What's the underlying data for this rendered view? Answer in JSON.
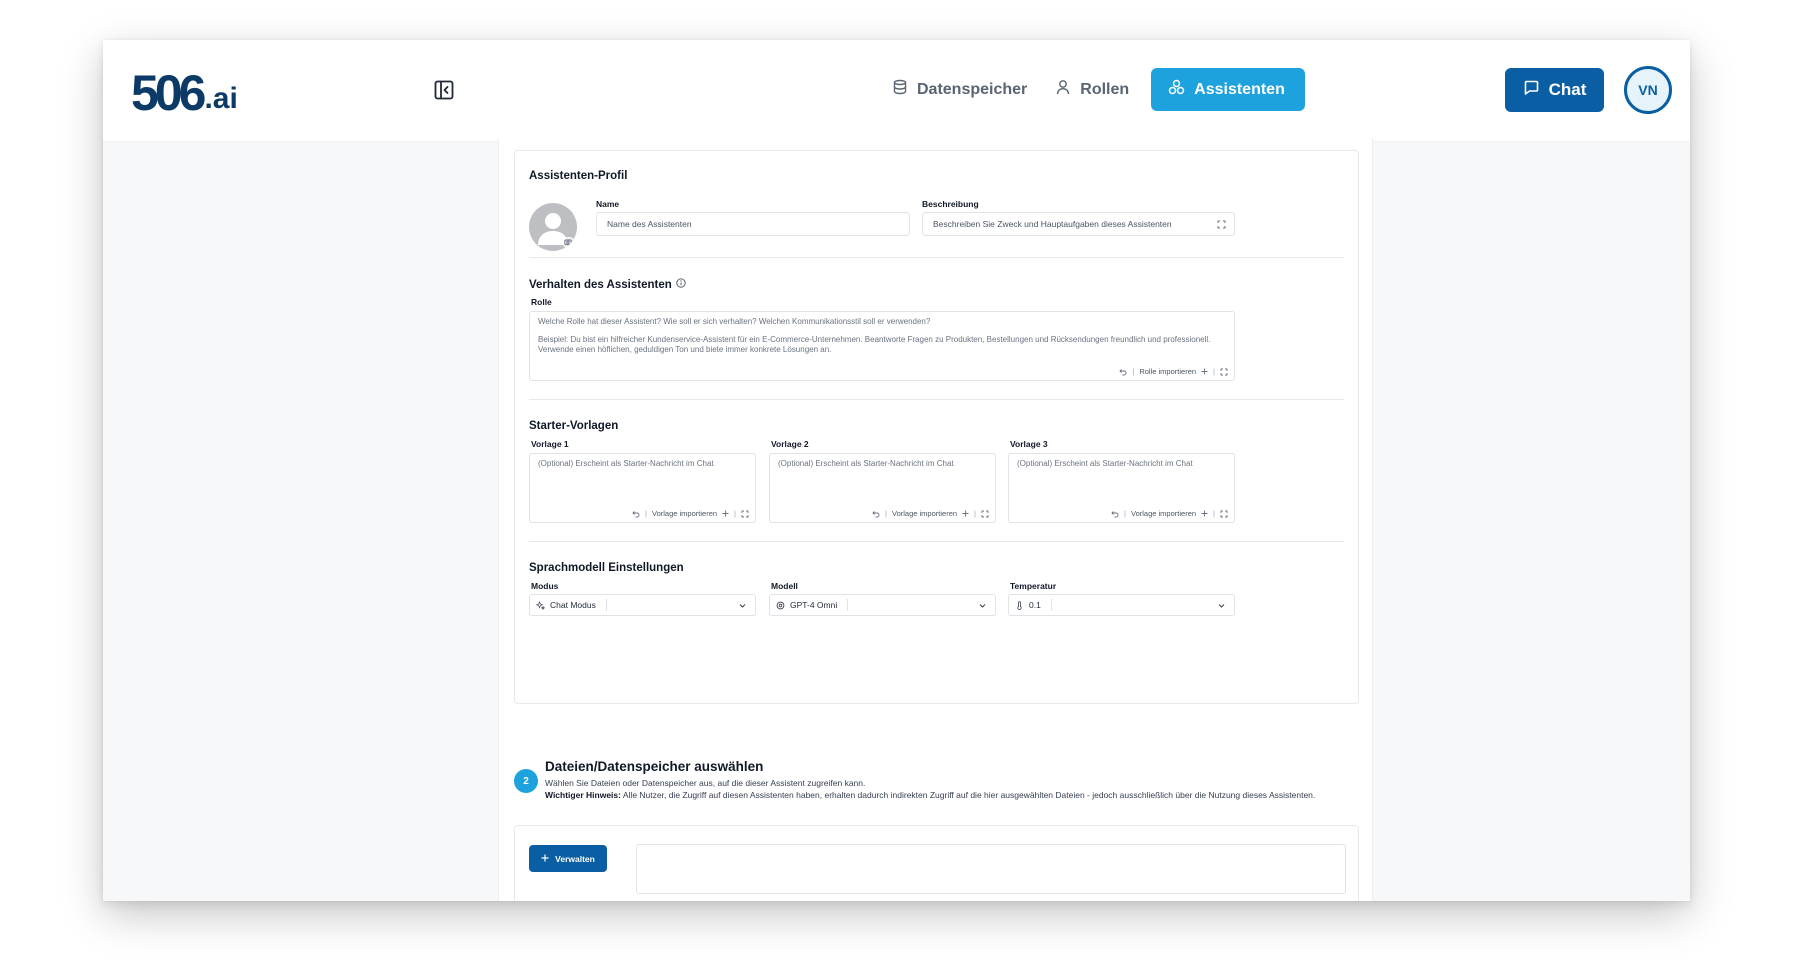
{
  "app": {
    "logo_main": "506",
    "logo_suffix": ".ai"
  },
  "nav": {
    "items": [
      {
        "label": "Datenspeicher",
        "icon": "database-icon",
        "active": false
      },
      {
        "label": "Rollen",
        "icon": "user-icon",
        "active": false
      },
      {
        "label": "Assistenten",
        "icon": "assistants-icon",
        "active": true
      }
    ],
    "chat_label": "Chat",
    "avatar_initials": "VN"
  },
  "profile": {
    "title": "Assistenten-Profil",
    "name_label": "Name",
    "name_placeholder": "Name des Assistenten",
    "description_label": "Beschreibung",
    "description_placeholder": "Beschreiben Sie Zweck und Hauptaufgaben dieses Assistenten"
  },
  "behavior": {
    "title": "Verhalten des Assistenten",
    "role_label": "Rolle",
    "role_question": "Welche Rolle hat dieser Assistent? Wie soll er sich verhalten? Welchen Kommunikationsstil soll er verwenden?",
    "role_example_1": "Beispiel: Du bist ein hilfreicher Kundenservice-Assistent für ein E-Commerce-Unternehmen. Beantworte Fragen zu Produkten, Bestellungen und Rücksendungen freundlich und professionell.",
    "role_example_2": "Verwende einen höflichen, geduldigen Ton und biete immer konkrete Lösungen an.",
    "import_label": "Rolle importieren"
  },
  "starters": {
    "title": "Starter-Vorlagen",
    "import_label": "Vorlage importieren",
    "items": [
      {
        "label": "Vorlage 1",
        "placeholder": "(Optional) Erscheint als Starter-Nachricht im Chat"
      },
      {
        "label": "Vorlage 2",
        "placeholder": "(Optional) Erscheint als Starter-Nachricht im Chat"
      },
      {
        "label": "Vorlage 3",
        "placeholder": "(Optional) Erscheint als Starter-Nachricht im Chat"
      }
    ]
  },
  "model_settings": {
    "title": "Sprachmodell Einstellungen",
    "mode_label": "Modus",
    "mode_value": "Chat Modus",
    "model_label": "Modell",
    "model_value": "GPT-4 Omni",
    "temperature_label": "Temperatur",
    "temperature_value": "0.1"
  },
  "files": {
    "step_number": "2",
    "title": "Dateien/Datenspeicher auswählen",
    "description": "Wählen Sie Dateien oder Datenspeicher aus, auf die dieser Assistent zugreifen kann.",
    "notice_label": "Wichtiger Hinweis:",
    "notice_text": "Alle Nutzer, die Zugriff auf diesen Assistenten haben, erhalten dadurch indirekten Zugriff auf die hier ausgewählten Dateien - jedoch ausschließlich über die Nutzung dieses Assistenten.",
    "manage_label": "Verwalten"
  },
  "colors": {
    "brand_dark": "#0a5ea3",
    "brand_light": "#1ea2dd",
    "logo": "#0b3a66"
  }
}
